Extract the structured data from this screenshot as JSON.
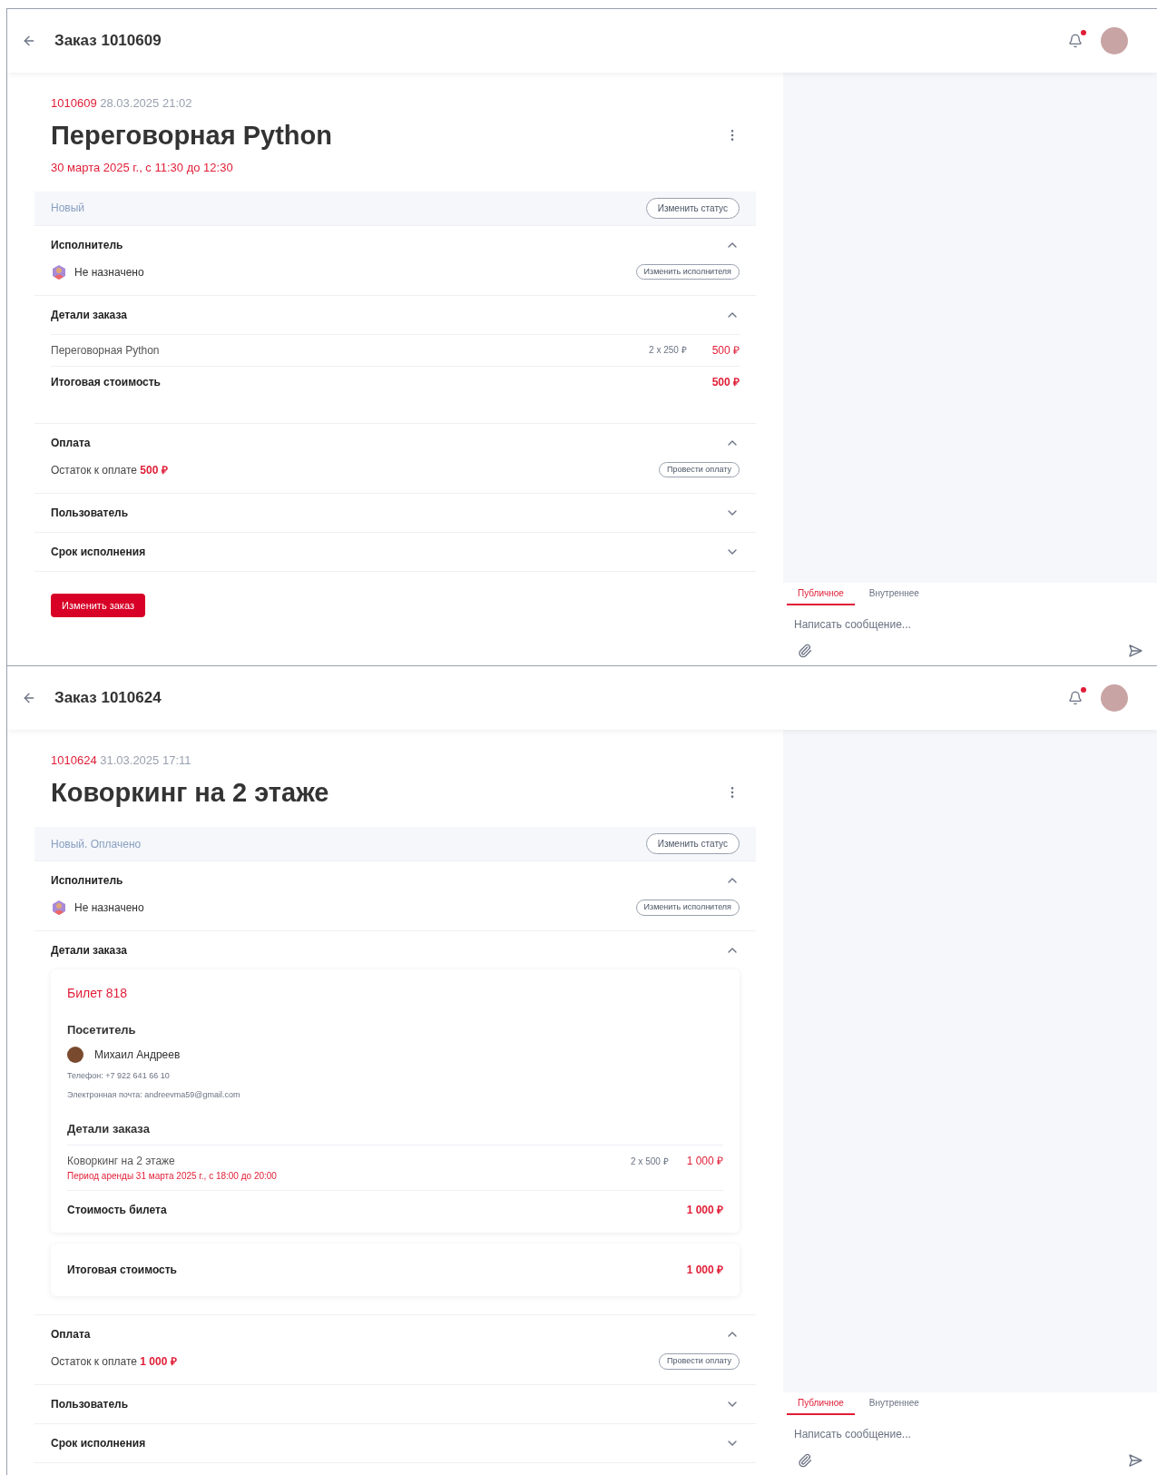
{
  "panels": [
    {
      "header": {
        "title": "Заказ 1010609"
      },
      "order_id": "1010609",
      "created": "28.03.2025 21:02",
      "title": "Переговорная Python",
      "schedule": "30 марта 2025 г., с 11:30 до 12:30",
      "status": {
        "text": "Новый",
        "button": "Изменить статус"
      },
      "sections": [
        {
          "kind": "performer",
          "title": "Исполнитель",
          "expanded": true,
          "name": "Не назначено",
          "button": "Изменить исполнителя"
        },
        {
          "kind": "details",
          "title": "Детали заказа",
          "expanded": true,
          "items": [
            {
              "name": "Переговорная Python",
              "qty": "2 x 250 ₽",
              "price": "500 ₽"
            }
          ],
          "total": {
            "label": "Итоговая стоимость",
            "value": "500 ₽"
          }
        },
        {
          "kind": "payment",
          "title": "Оплата",
          "expanded": true,
          "label": "Остаток к оплате",
          "amount": "500 ₽",
          "button": "Провести оплату"
        },
        {
          "title": "Пользователь",
          "expanded": false
        },
        {
          "title": "Срок исполнения",
          "expanded": false
        }
      ],
      "edit_button": "Изменить заказ",
      "chat": {
        "tabs": [
          {
            "label": "Публичное",
            "selected": true
          },
          {
            "label": "Внутреннее",
            "selected": false
          }
        ],
        "placeholder": "Написать сообщение..."
      }
    },
    {
      "header": {
        "title": "Заказ 1010624"
      },
      "order_id": "1010624",
      "created": "31.03.2025 17:11",
      "title": "Коворкинг на 2 этаже",
      "status": {
        "text": "Новый. Оплачено",
        "button": "Изменить статус"
      },
      "sections": [
        {
          "kind": "performer",
          "title": "Исполнитель",
          "expanded": true,
          "name": "Не назначено",
          "button": "Изменить исполнителя"
        },
        {
          "kind": "tickets",
          "title": "Детали заказа",
          "expanded": true,
          "ticket": {
            "title": "Билет 818",
            "visitor_heading": "Посетитель",
            "visitor_name": "Михаил Андреев",
            "phone": "Телефон: +7 922 641 66 10",
            "email": "Электронная почта: andreevma59@gmail.com",
            "details_heading": "Детали заказа",
            "items": [
              {
                "name": "Коворкинг на 2 этаже",
                "note": "Период аренды 31 марта 2025 г., с 18:00 до 20:00",
                "qty": "2 x 500 ₽",
                "price": "1 000 ₽"
              }
            ],
            "ticket_total": {
              "label": "Стоимость билета",
              "value": "1 000 ₽"
            }
          },
          "total": {
            "label": "Итоговая стоимость",
            "value": "1 000 ₽"
          }
        },
        {
          "kind": "payment",
          "title": "Оплата",
          "expanded": true,
          "label": "Остаток к оплате",
          "amount": "1 000 ₽",
          "button": "Провести оплату"
        },
        {
          "title": "Пользователь",
          "expanded": false
        },
        {
          "title": "Срок исполнения",
          "expanded": false
        }
      ],
      "chat": {
        "tabs": [
          {
            "label": "Публичное",
            "selected": true
          },
          {
            "label": "Внутреннее",
            "selected": false
          }
        ],
        "placeholder": "Написать сообщение..."
      }
    }
  ]
}
